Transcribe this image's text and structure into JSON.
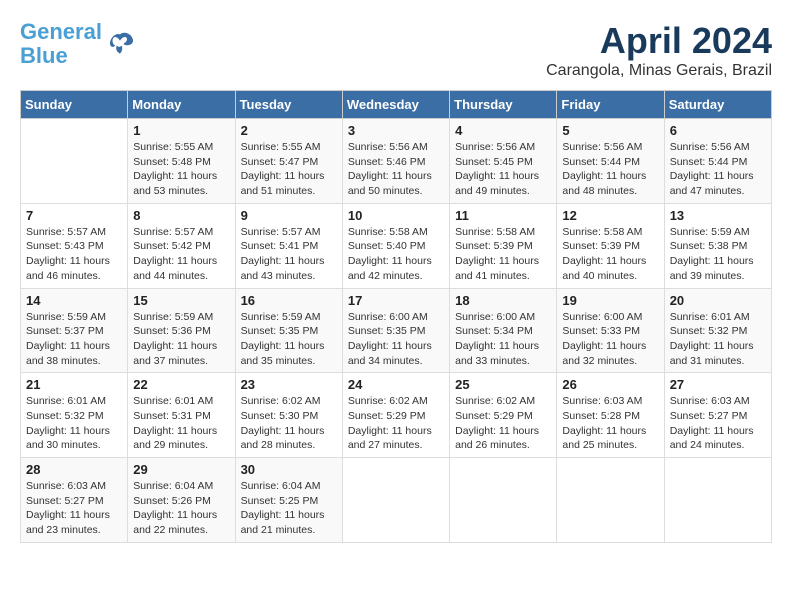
{
  "logo": {
    "line1": "General",
    "line2": "Blue"
  },
  "title": "April 2024",
  "subtitle": "Carangola, Minas Gerais, Brazil",
  "weekdays": [
    "Sunday",
    "Monday",
    "Tuesday",
    "Wednesday",
    "Thursday",
    "Friday",
    "Saturday"
  ],
  "weeks": [
    [
      {
        "day": "",
        "info": ""
      },
      {
        "day": "1",
        "info": "Sunrise: 5:55 AM\nSunset: 5:48 PM\nDaylight: 11 hours\nand 53 minutes."
      },
      {
        "day": "2",
        "info": "Sunrise: 5:55 AM\nSunset: 5:47 PM\nDaylight: 11 hours\nand 51 minutes."
      },
      {
        "day": "3",
        "info": "Sunrise: 5:56 AM\nSunset: 5:46 PM\nDaylight: 11 hours\nand 50 minutes."
      },
      {
        "day": "4",
        "info": "Sunrise: 5:56 AM\nSunset: 5:45 PM\nDaylight: 11 hours\nand 49 minutes."
      },
      {
        "day": "5",
        "info": "Sunrise: 5:56 AM\nSunset: 5:44 PM\nDaylight: 11 hours\nand 48 minutes."
      },
      {
        "day": "6",
        "info": "Sunrise: 5:56 AM\nSunset: 5:44 PM\nDaylight: 11 hours\nand 47 minutes."
      }
    ],
    [
      {
        "day": "7",
        "info": "Sunrise: 5:57 AM\nSunset: 5:43 PM\nDaylight: 11 hours\nand 46 minutes."
      },
      {
        "day": "8",
        "info": "Sunrise: 5:57 AM\nSunset: 5:42 PM\nDaylight: 11 hours\nand 44 minutes."
      },
      {
        "day": "9",
        "info": "Sunrise: 5:57 AM\nSunset: 5:41 PM\nDaylight: 11 hours\nand 43 minutes."
      },
      {
        "day": "10",
        "info": "Sunrise: 5:58 AM\nSunset: 5:40 PM\nDaylight: 11 hours\nand 42 minutes."
      },
      {
        "day": "11",
        "info": "Sunrise: 5:58 AM\nSunset: 5:39 PM\nDaylight: 11 hours\nand 41 minutes."
      },
      {
        "day": "12",
        "info": "Sunrise: 5:58 AM\nSunset: 5:39 PM\nDaylight: 11 hours\nand 40 minutes."
      },
      {
        "day": "13",
        "info": "Sunrise: 5:59 AM\nSunset: 5:38 PM\nDaylight: 11 hours\nand 39 minutes."
      }
    ],
    [
      {
        "day": "14",
        "info": "Sunrise: 5:59 AM\nSunset: 5:37 PM\nDaylight: 11 hours\nand 38 minutes."
      },
      {
        "day": "15",
        "info": "Sunrise: 5:59 AM\nSunset: 5:36 PM\nDaylight: 11 hours\nand 37 minutes."
      },
      {
        "day": "16",
        "info": "Sunrise: 5:59 AM\nSunset: 5:35 PM\nDaylight: 11 hours\nand 35 minutes."
      },
      {
        "day": "17",
        "info": "Sunrise: 6:00 AM\nSunset: 5:35 PM\nDaylight: 11 hours\nand 34 minutes."
      },
      {
        "day": "18",
        "info": "Sunrise: 6:00 AM\nSunset: 5:34 PM\nDaylight: 11 hours\nand 33 minutes."
      },
      {
        "day": "19",
        "info": "Sunrise: 6:00 AM\nSunset: 5:33 PM\nDaylight: 11 hours\nand 32 minutes."
      },
      {
        "day": "20",
        "info": "Sunrise: 6:01 AM\nSunset: 5:32 PM\nDaylight: 11 hours\nand 31 minutes."
      }
    ],
    [
      {
        "day": "21",
        "info": "Sunrise: 6:01 AM\nSunset: 5:32 PM\nDaylight: 11 hours\nand 30 minutes."
      },
      {
        "day": "22",
        "info": "Sunrise: 6:01 AM\nSunset: 5:31 PM\nDaylight: 11 hours\nand 29 minutes."
      },
      {
        "day": "23",
        "info": "Sunrise: 6:02 AM\nSunset: 5:30 PM\nDaylight: 11 hours\nand 28 minutes."
      },
      {
        "day": "24",
        "info": "Sunrise: 6:02 AM\nSunset: 5:29 PM\nDaylight: 11 hours\nand 27 minutes."
      },
      {
        "day": "25",
        "info": "Sunrise: 6:02 AM\nSunset: 5:29 PM\nDaylight: 11 hours\nand 26 minutes."
      },
      {
        "day": "26",
        "info": "Sunrise: 6:03 AM\nSunset: 5:28 PM\nDaylight: 11 hours\nand 25 minutes."
      },
      {
        "day": "27",
        "info": "Sunrise: 6:03 AM\nSunset: 5:27 PM\nDaylight: 11 hours\nand 24 minutes."
      }
    ],
    [
      {
        "day": "28",
        "info": "Sunrise: 6:03 AM\nSunset: 5:27 PM\nDaylight: 11 hours\nand 23 minutes."
      },
      {
        "day": "29",
        "info": "Sunrise: 6:04 AM\nSunset: 5:26 PM\nDaylight: 11 hours\nand 22 minutes."
      },
      {
        "day": "30",
        "info": "Sunrise: 6:04 AM\nSunset: 5:25 PM\nDaylight: 11 hours\nand 21 minutes."
      },
      {
        "day": "",
        "info": ""
      },
      {
        "day": "",
        "info": ""
      },
      {
        "day": "",
        "info": ""
      },
      {
        "day": "",
        "info": ""
      }
    ]
  ]
}
